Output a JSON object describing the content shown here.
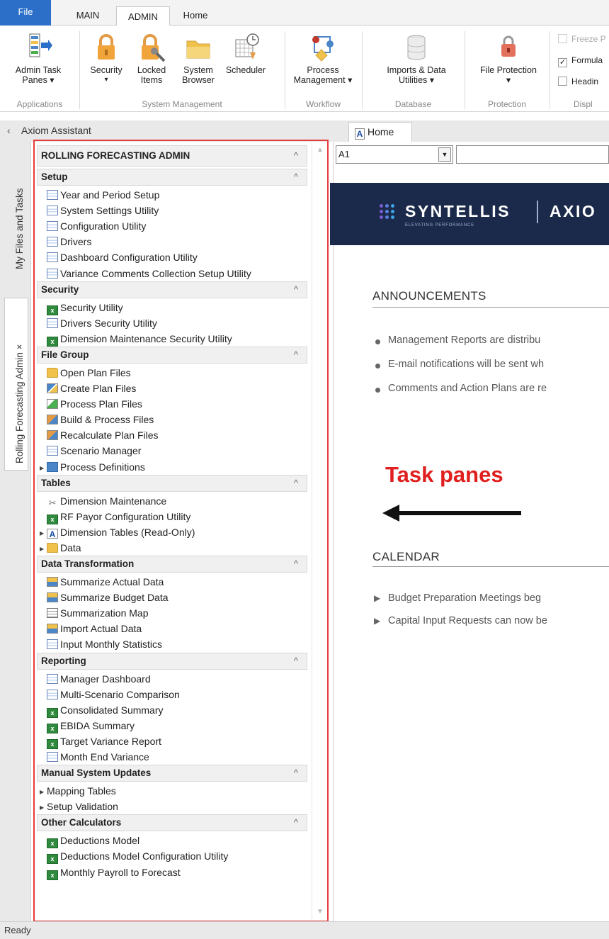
{
  "ribbon": {
    "tabs": [
      "File",
      "MAIN",
      "ADMIN",
      "Home"
    ],
    "buttons": {
      "admin_task_panes": "Admin Task Panes ▾",
      "security": "Security",
      "security_arrow": "▾",
      "locked_items": "Locked Items",
      "system_browser": "System Browser",
      "scheduler": "Scheduler",
      "process_management": "Process Management ▾",
      "imports_data_utilities": "Imports & Data Utilities ▾",
      "file_protection": "File Protection ▾"
    },
    "groups": [
      "Applications",
      "System Management",
      "Workflow",
      "Database",
      "Protection",
      "Displ"
    ],
    "checks": [
      {
        "label": "Freeze P",
        "checked": false,
        "disabled": true
      },
      {
        "label": "Formula",
        "checked": true,
        "disabled": false
      },
      {
        "label": "Headin",
        "checked": false,
        "disabled": false
      }
    ]
  },
  "assistant": {
    "title": "Axiom Assistant",
    "collapse_glyph": "‹"
  },
  "doc_tab": {
    "icon": "A",
    "label": "Home"
  },
  "side_tabs": {
    "files": "My Files and Tasks",
    "rfa": "Rolling Forecasting Admin ×"
  },
  "pane": {
    "title": "ROLLING FORECASTING ADMIN",
    "caret": "^",
    "sections": [
      {
        "title": "Setup",
        "items": [
          {
            "label": "Year and Period Setup",
            "icon": "doc-icon"
          },
          {
            "label": "System Settings Utility",
            "icon": "doc-icon"
          },
          {
            "label": "Configuration Utility",
            "icon": "doc-icon"
          },
          {
            "label": "Drivers",
            "icon": "doc-icon"
          },
          {
            "label": "Dashboard Configuration Utility",
            "icon": "doc-icon"
          },
          {
            "label": "Variance Comments Collection Setup Utility",
            "icon": "doc-icon"
          }
        ]
      },
      {
        "title": "Security",
        "items": [
          {
            "label": "Security Utility",
            "icon": "excel-icon"
          },
          {
            "label": "Drivers Security Utility",
            "icon": "doc-icon"
          },
          {
            "label": "Dimension Maintenance Security Utility",
            "icon": "excel-icon"
          }
        ]
      },
      {
        "title": "File Group",
        "items": [
          {
            "label": "Open Plan Files",
            "icon": "folder-icon"
          },
          {
            "label": "Create Plan Files",
            "icon": "pencil-icon"
          },
          {
            "label": "Process Plan Files",
            "icon": "process-icon"
          },
          {
            "label": "Build & Process Files",
            "icon": "build-icon"
          },
          {
            "label": "Recalculate Plan Files",
            "icon": "build-icon"
          },
          {
            "label": "Scenario Manager",
            "icon": "doc-icon"
          },
          {
            "label": "Process Definitions",
            "icon": "database-icon",
            "expandable": true
          }
        ]
      },
      {
        "title": "Tables",
        "items": [
          {
            "label": "Dimension Maintenance",
            "icon": "wrench-icon"
          },
          {
            "label": "RF Payor Configuration Utility",
            "icon": "excel-icon"
          },
          {
            "label": "Dimension Tables (Read-Only)",
            "icon": "axiom-a-icon",
            "expandable": true
          },
          {
            "label": "Data",
            "icon": "folder-icon",
            "expandable": true
          }
        ]
      },
      {
        "title": "Data Transformation",
        "items": [
          {
            "label": "Summarize Actual Data",
            "icon": "summarize-icon"
          },
          {
            "label": "Summarize Budget Data",
            "icon": "summarize-icon"
          },
          {
            "label": "Summarization Map",
            "icon": "grid-icon"
          },
          {
            "label": "Import Actual Data",
            "icon": "summarize-icon"
          },
          {
            "label": "Input Monthly Statistics",
            "icon": "doc-icon"
          }
        ]
      },
      {
        "title": "Reporting",
        "items": [
          {
            "label": "Manager Dashboard",
            "icon": "doc-icon"
          },
          {
            "label": "Multi-Scenario Comparison",
            "icon": "doc-icon"
          },
          {
            "label": "Consolidated Summary",
            "icon": "excel-icon"
          },
          {
            "label": "EBIDA Summary",
            "icon": "excel-icon"
          },
          {
            "label": "Target Variance Report",
            "icon": "excel-icon"
          },
          {
            "label": "Month End Variance",
            "icon": "doc-icon"
          }
        ]
      },
      {
        "title": "Manual System Updates",
        "items": [
          {
            "label": "Mapping Tables",
            "icon": "",
            "expandable": true
          },
          {
            "label": "Setup Validation",
            "icon": "",
            "expandable": true
          }
        ]
      },
      {
        "title": "Other Calculators",
        "items": [
          {
            "label": "Deductions Model",
            "icon": "excel-icon"
          },
          {
            "label": "Deductions Model Configuration Utility",
            "icon": "excel-icon"
          },
          {
            "label": "Monthly Payroll to Forecast",
            "icon": "excel-icon"
          }
        ]
      }
    ]
  },
  "sheet": {
    "namebox": "A1",
    "namebox_dropdown": "▼",
    "logo": {
      "name": "SYNTELLIS",
      "tagline": "ELEVATING PERFORMANCE",
      "product": "AXIO"
    },
    "announcements_heading": "ANNOUNCEMENTS",
    "announcements": [
      "Management Reports are distribu",
      "E-mail notifications will be sent wh",
      "Comments and Action Plans are re"
    ],
    "calendar_heading": "CALENDAR",
    "calendar": [
      "Budget Preparation Meetings beg",
      "Capital Input Requests can now be"
    ]
  },
  "annotation": {
    "label": "Task panes"
  },
  "status": {
    "text": "Ready"
  },
  "colors": {
    "file_tab": "#2b6fc9",
    "highlight": "#e63c3c",
    "banner": "#1b2a4a",
    "annotation": "#e01f1f"
  }
}
